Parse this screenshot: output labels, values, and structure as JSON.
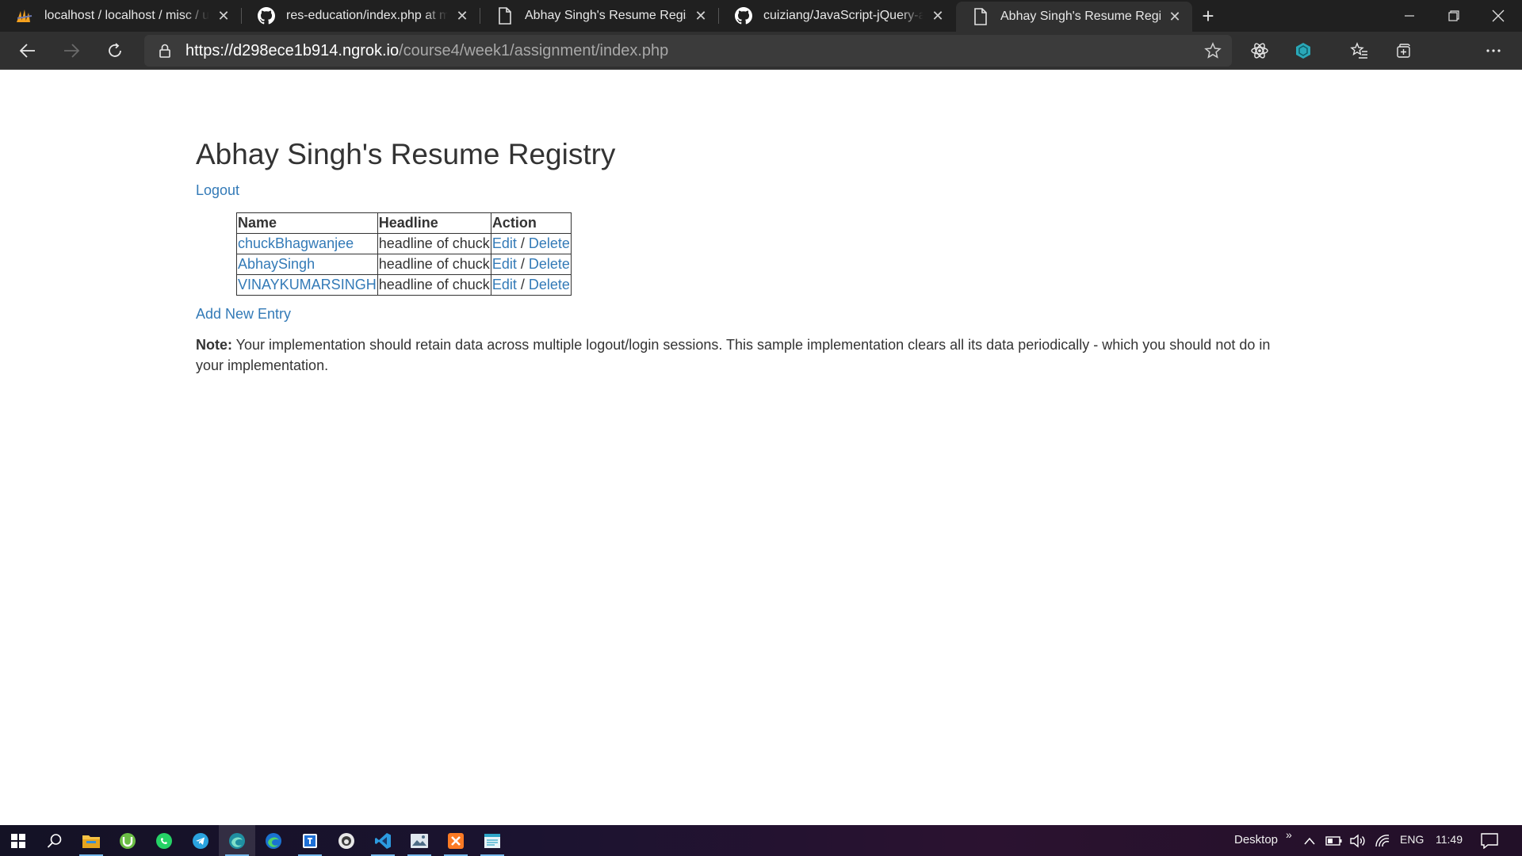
{
  "browser": {
    "tabs": [
      {
        "title": "localhost / localhost / misc / use",
        "favicon": "phpmyadmin-icon"
      },
      {
        "title": "res-education/index.php at mast",
        "favicon": "github-icon"
      },
      {
        "title": "Abhay Singh's Resume Registry",
        "favicon": "page-icon"
      },
      {
        "title": "cuiziang/JavaScript-jQuery-and-",
        "favicon": "github-icon"
      },
      {
        "title": "Abhay Singh's Resume Registry",
        "favicon": "page-icon",
        "active": true
      }
    ],
    "address": {
      "prefix": "https://",
      "host": "d298ece1b914.ngrok.io",
      "path": "/course4/week1/assignment/index.php"
    }
  },
  "page": {
    "title": "Abhay Singh's Resume Registry",
    "logout_label": "Logout",
    "table": {
      "headers": [
        "Name",
        "Headline",
        "Action"
      ],
      "rows": [
        {
          "name": "chuckBhagwanjee",
          "headline": "headline of chuck",
          "edit": "Edit",
          "sep": " / ",
          "delete": "Delete"
        },
        {
          "name": "AbhaySingh",
          "headline": "headline of chuck",
          "edit": "Edit",
          "sep": " / ",
          "delete": "Delete"
        },
        {
          "name": "VINAYKUMARSINGH",
          "headline": "headline of chuck",
          "edit": "Edit",
          "sep": " / ",
          "delete": "Delete"
        }
      ]
    },
    "add_new_label": "Add New Entry",
    "note": {
      "label": "Note:",
      "text": " Your implementation should retain data across multiple logout/login sessions. This sample implementation clears all its data periodically - which you should not do in your implementation."
    }
  },
  "taskbar": {
    "apps": [
      "start-icon",
      "search-icon",
      "file-explorer-icon",
      "utorrent-icon",
      "whatsapp-icon",
      "telegram-icon",
      "edge-dev-icon",
      "edge-icon",
      "app-icon",
      "github-desktop-icon",
      "vscode-icon",
      "photos-icon",
      "xampp-icon",
      "notepad-icon"
    ],
    "desktop_label": "Desktop",
    "language": "ENG",
    "time": "11:49"
  },
  "colors": {
    "link": "#337ab7",
    "tabbar_bg": "#202020",
    "toolbar_bg": "#303030"
  }
}
